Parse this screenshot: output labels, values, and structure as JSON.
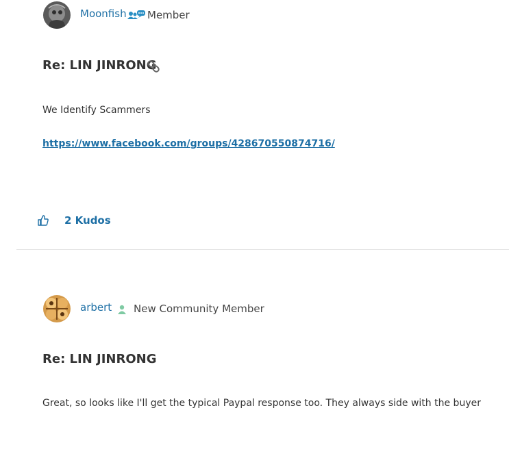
{
  "posts": [
    {
      "author": "Moonfish",
      "rank": "Member",
      "rank_icon": "users-chat-icon",
      "title": "Re: LIN JINRONG",
      "title_icon": "link-icon",
      "body": "We Identify Scammers",
      "link": "https://www.facebook.com/groups/428670550874716/",
      "kudos_label": "2 Kudos",
      "kudos_icon": "thumbs-up-icon"
    },
    {
      "author": "arbert",
      "rank": "New Community Member",
      "rank_icon": "user-icon",
      "title": "Re: LIN JINRONG",
      "body": "Great, so looks like I'll get the typical Paypal response too.  They always side with the buyer"
    }
  ],
  "colors": {
    "link": "#1d6fa5",
    "rank_icon_member": "#2a8fc4",
    "rank_icon_new": "#7fcaa3",
    "divider": "#e5e5e5"
  }
}
